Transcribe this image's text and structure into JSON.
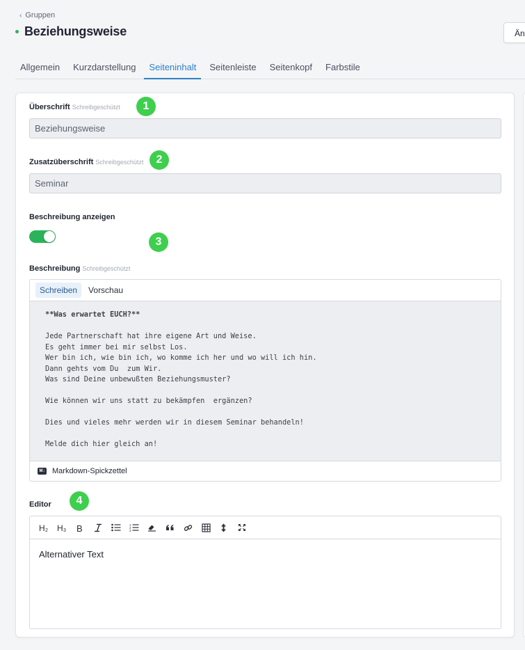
{
  "nav": {
    "back_label": "Gruppen"
  },
  "page": {
    "title": "Beziehungsweise",
    "top_button_label": "Ändern"
  },
  "tabs": [
    {
      "label": "Allgemein"
    },
    {
      "label": "Kurzdarstellung"
    },
    {
      "label": "Seiteninhalt",
      "active": true
    },
    {
      "label": "Seitenleiste"
    },
    {
      "label": "Seitenkopf"
    },
    {
      "label": "Farbstile"
    }
  ],
  "form": {
    "heading": {
      "label": "Überschrift",
      "hint": "Schreibgeschützt",
      "value": "Beziehungsweise"
    },
    "subheading": {
      "label": "Zusatzüberschrift",
      "hint": "Schreibgeschützt",
      "value": "Seminar"
    },
    "show_description": {
      "label": "Beschreibung anzeigen",
      "enabled": true
    },
    "description": {
      "label": "Beschreibung",
      "hint": "Schreibgeschützt",
      "tabs": {
        "write": "Schreiben",
        "preview": "Vorschau"
      },
      "lines": [
        "**Was erwartet EUCH?**",
        "",
        "Jede Partnerschaft hat ihre eigene Art und Weise.",
        "Es geht immer bei mir selbst Los.",
        "Wer bin ich, wie bin ich, wo komme ich her und wo will ich hin.",
        "Dann gehts vom Du  zum Wir.",
        "Was sind Deine unbewußten Beziehungsmuster?",
        "",
        "Wie können wir uns statt zu bekämpfen  ergänzen?",
        "",
        "Dies und vieles mehr werden wir in diesem Seminar behandeln!",
        "",
        "Melde dich hier gleich an!"
      ],
      "footer_label": "Markdown-Spickzettel",
      "footer_icon": "markdown-icon"
    },
    "editor": {
      "label": "Editor",
      "content": "Alternativer Text",
      "toolbar": [
        {
          "name": "heading-2-icon",
          "glyph": "H2"
        },
        {
          "name": "heading-3-icon",
          "glyph": "H3"
        },
        {
          "name": "bold-icon",
          "glyph": "B"
        },
        {
          "name": "italic-icon",
          "glyph": "I"
        },
        {
          "name": "bullet-list-icon",
          "glyph": "ul"
        },
        {
          "name": "ordered-list-icon",
          "glyph": "ol"
        },
        {
          "name": "clear-format-icon",
          "glyph": "eraser"
        },
        {
          "name": "quote-icon",
          "glyph": "quote"
        },
        {
          "name": "link-icon",
          "glyph": "link"
        },
        {
          "name": "table-icon",
          "glyph": "table"
        },
        {
          "name": "line-height-icon",
          "glyph": "updown"
        },
        {
          "name": "fullscreen-icon",
          "glyph": "expand"
        }
      ]
    }
  },
  "annotations": [
    "1",
    "2",
    "3",
    "4"
  ],
  "colors": {
    "accent": "#2d7fc4",
    "toggle_on": "#2ab35a",
    "badge": "#3fcf4e",
    "status_dot": "#2bb35d"
  }
}
